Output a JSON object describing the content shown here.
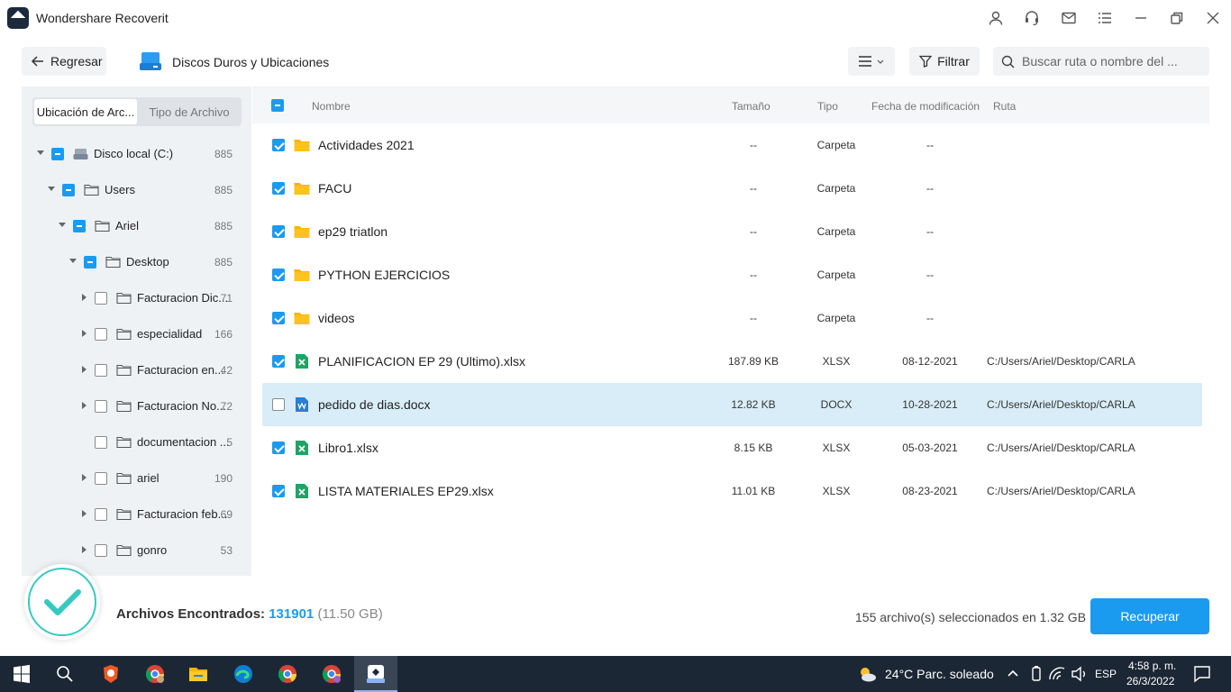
{
  "app": {
    "title": "Wondershare Recoverit"
  },
  "toolbar": {
    "back_label": "Regresar",
    "location_title": "Discos Duros y Ubicaciones",
    "filter_label": "Filtrar",
    "search_placeholder": "Buscar ruta o nombre del ..."
  },
  "sidebar": {
    "tabs": [
      "Ubicación de Arc...",
      "Tipo de Archivo"
    ],
    "tree": [
      {
        "label": "Disco local (C:)",
        "count": "885",
        "level": 0,
        "expanded": true,
        "state": "partial",
        "icon": "drive-icon"
      },
      {
        "label": "Users",
        "count": "885",
        "level": 1,
        "expanded": true,
        "state": "partial",
        "icon": "folder-icon"
      },
      {
        "label": "Ariel",
        "count": "885",
        "level": 2,
        "expanded": true,
        "state": "partial",
        "icon": "folder-icon"
      },
      {
        "label": "Desktop",
        "count": "885",
        "level": 3,
        "expanded": true,
        "state": "partial",
        "icon": "folder-icon"
      },
      {
        "label": "Facturacion Dic...",
        "count": "71",
        "level": 4,
        "expanded": false,
        "state": "none",
        "icon": "folder-icon"
      },
      {
        "label": "especialidad",
        "count": "166",
        "level": 4,
        "expanded": false,
        "state": "none",
        "icon": "folder-icon"
      },
      {
        "label": "Facturacion en...",
        "count": "42",
        "level": 4,
        "expanded": false,
        "state": "none",
        "icon": "folder-icon"
      },
      {
        "label": "Facturacion No...",
        "count": "72",
        "level": 4,
        "expanded": false,
        "state": "none",
        "icon": "folder-icon"
      },
      {
        "label": "documentacion ...",
        "count": "5",
        "level": 4,
        "expanded": null,
        "state": "none",
        "icon": "folder-icon"
      },
      {
        "label": "ariel",
        "count": "190",
        "level": 4,
        "expanded": false,
        "state": "none",
        "icon": "folder-icon"
      },
      {
        "label": "Facturacion feb...",
        "count": "69",
        "level": 4,
        "expanded": false,
        "state": "none",
        "icon": "folder-icon"
      },
      {
        "label": "gonro",
        "count": "53",
        "level": 4,
        "expanded": false,
        "state": "none",
        "icon": "folder-icon"
      }
    ]
  },
  "table": {
    "headers": {
      "name": "Nombre",
      "size": "Tamaño",
      "type": "Tipo",
      "date": "Fecha de modificación",
      "path": "Ruta"
    },
    "rows": [
      {
        "name": "Actividades 2021",
        "size": "--",
        "type": "Carpeta",
        "date": "--",
        "path": "",
        "icon": "folder-icon",
        "checked": true,
        "selected": false
      },
      {
        "name": "FACU",
        "size": "--",
        "type": "Carpeta",
        "date": "--",
        "path": "",
        "icon": "folder-icon",
        "checked": true,
        "selected": false
      },
      {
        "name": "ep29 triatlon",
        "size": "--",
        "type": "Carpeta",
        "date": "--",
        "path": "",
        "icon": "folder-icon",
        "checked": true,
        "selected": false
      },
      {
        "name": "PYTHON EJERCICIOS",
        "size": "--",
        "type": "Carpeta",
        "date": "--",
        "path": "",
        "icon": "folder-icon",
        "checked": true,
        "selected": false
      },
      {
        "name": "videos",
        "size": "--",
        "type": "Carpeta",
        "date": "--",
        "path": "",
        "icon": "folder-icon",
        "checked": true,
        "selected": false
      },
      {
        "name": "PLANIFICACION EP 29 (Ultimo).xlsx",
        "size": "187.89 KB",
        "type": "XLSX",
        "date": "08-12-2021",
        "path": "C:/Users/Ariel/Desktop/CARLA",
        "icon": "excel-icon",
        "checked": true,
        "selected": false
      },
      {
        "name": "pedido de dias.docx",
        "size": "12.82 KB",
        "type": "DOCX",
        "date": "10-28-2021",
        "path": "C:/Users/Ariel/Desktop/CARLA",
        "icon": "word-icon",
        "checked": false,
        "selected": true
      },
      {
        "name": "Libro1.xlsx",
        "size": "8.15 KB",
        "type": "XLSX",
        "date": "05-03-2021",
        "path": "C:/Users/Ariel/Desktop/CARLA",
        "icon": "excel-icon",
        "checked": true,
        "selected": false
      },
      {
        "name": "LISTA MATERIALES EP29.xlsx",
        "size": "11.01 KB",
        "type": "XLSX",
        "date": "08-23-2021",
        "path": "C:/Users/Ariel/Desktop/CARLA",
        "icon": "excel-icon",
        "checked": true,
        "selected": false
      }
    ]
  },
  "footer": {
    "found_label": "Archivos Encontrados:",
    "found_count": "131901",
    "found_size": "(11.50 GB)",
    "selected_info": "155 archivo(s) seleccionados en 1.32 GB",
    "recover_label": "Recuperar"
  },
  "taskbar": {
    "weather": "24°C  Parc. soleado",
    "lang": "ESP",
    "time": "4:58 p. m.",
    "date": "26/3/2022"
  },
  "colors": {
    "accent": "#1a9bf0",
    "folder": "#f7b500",
    "excel": "#21a366",
    "word": "#2b7cd3",
    "selected_row": "#d9edf8"
  }
}
